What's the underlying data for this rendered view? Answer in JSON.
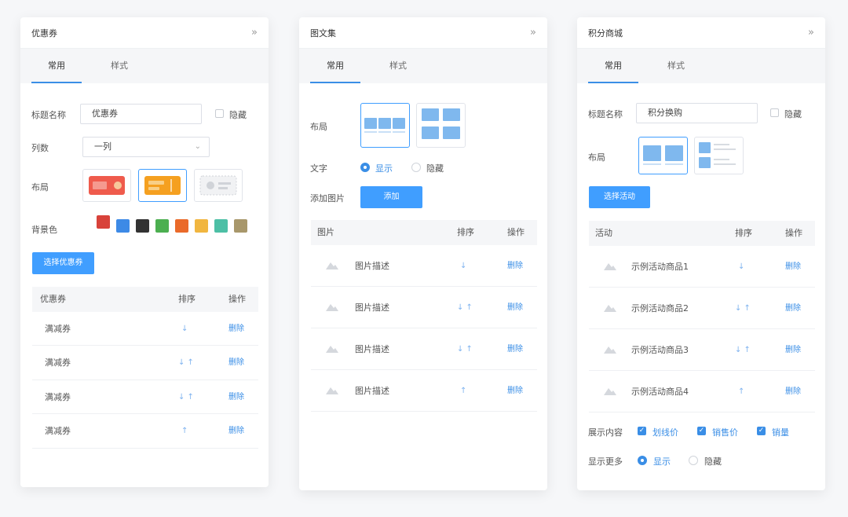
{
  "colors": {
    "accent": "#409eff",
    "swatches": [
      "#d8423a",
      "#3d8ae6",
      "#333333",
      "#4caf50",
      "#ea6a2a",
      "#f1b640",
      "#4cbfa5",
      "#a8976b"
    ]
  },
  "coupon_panel": {
    "title": "优惠券",
    "tabs": [
      "常用",
      "样式"
    ],
    "title_label": "标题名称",
    "title_value": "优惠券",
    "hide_label": "隐藏",
    "columns_label": "列数",
    "columns_value": "一列",
    "layout_label": "布局",
    "bg_label": "背景色",
    "select_button": "选择优惠券",
    "table": {
      "headers": [
        "优惠券",
        "排序",
        "操作"
      ],
      "rows": [
        {
          "name": "满减券",
          "sort": "↓",
          "action": "删除"
        },
        {
          "name": "满减券",
          "sort": "↓ ↑",
          "action": "删除"
        },
        {
          "name": "满减券",
          "sort": "↓ ↑",
          "action": "删除"
        },
        {
          "name": "满减券",
          "sort": "↑",
          "action": "删除"
        }
      ]
    }
  },
  "gallery_panel": {
    "title": "图文集",
    "tabs": [
      "常用",
      "样式"
    ],
    "layout_label": "布局",
    "text_label": "文字",
    "show_label": "显示",
    "hide_label": "隐藏",
    "add_image_label": "添加图片",
    "add_button": "添加",
    "table": {
      "headers": [
        "图片",
        "排序",
        "操作"
      ],
      "rows": [
        {
          "desc": "图片描述",
          "sort": "↓",
          "action": "删除"
        },
        {
          "desc": "图片描述",
          "sort": "↓ ↑",
          "action": "删除"
        },
        {
          "desc": "图片描述",
          "sort": "↓ ↑",
          "action": "删除"
        },
        {
          "desc": "图片描述",
          "sort": "↑",
          "action": "删除"
        }
      ]
    }
  },
  "points_panel": {
    "title": "积分商城",
    "tabs": [
      "常用",
      "样式"
    ],
    "title_label": "标题名称",
    "title_value": "积分换购",
    "hide_label": "隐藏",
    "layout_label": "布局",
    "select_button": "选择活动",
    "table": {
      "headers": [
        "活动",
        "排序",
        "操作"
      ],
      "rows": [
        {
          "name": "示例活动商品1",
          "sort": "↓",
          "action": "删除"
        },
        {
          "name": "示例活动商品2",
          "sort": "↓ ↑",
          "action": "删除"
        },
        {
          "name": "示例活动商品3",
          "sort": "↓ ↑",
          "action": "删除"
        },
        {
          "name": "示例活动商品4",
          "sort": "↑",
          "action": "删除"
        }
      ]
    },
    "display_label": "展示内容",
    "display_options": [
      "划线价",
      "销售价",
      "销量"
    ],
    "more_label": "显示更多",
    "show_label": "显示"
  }
}
